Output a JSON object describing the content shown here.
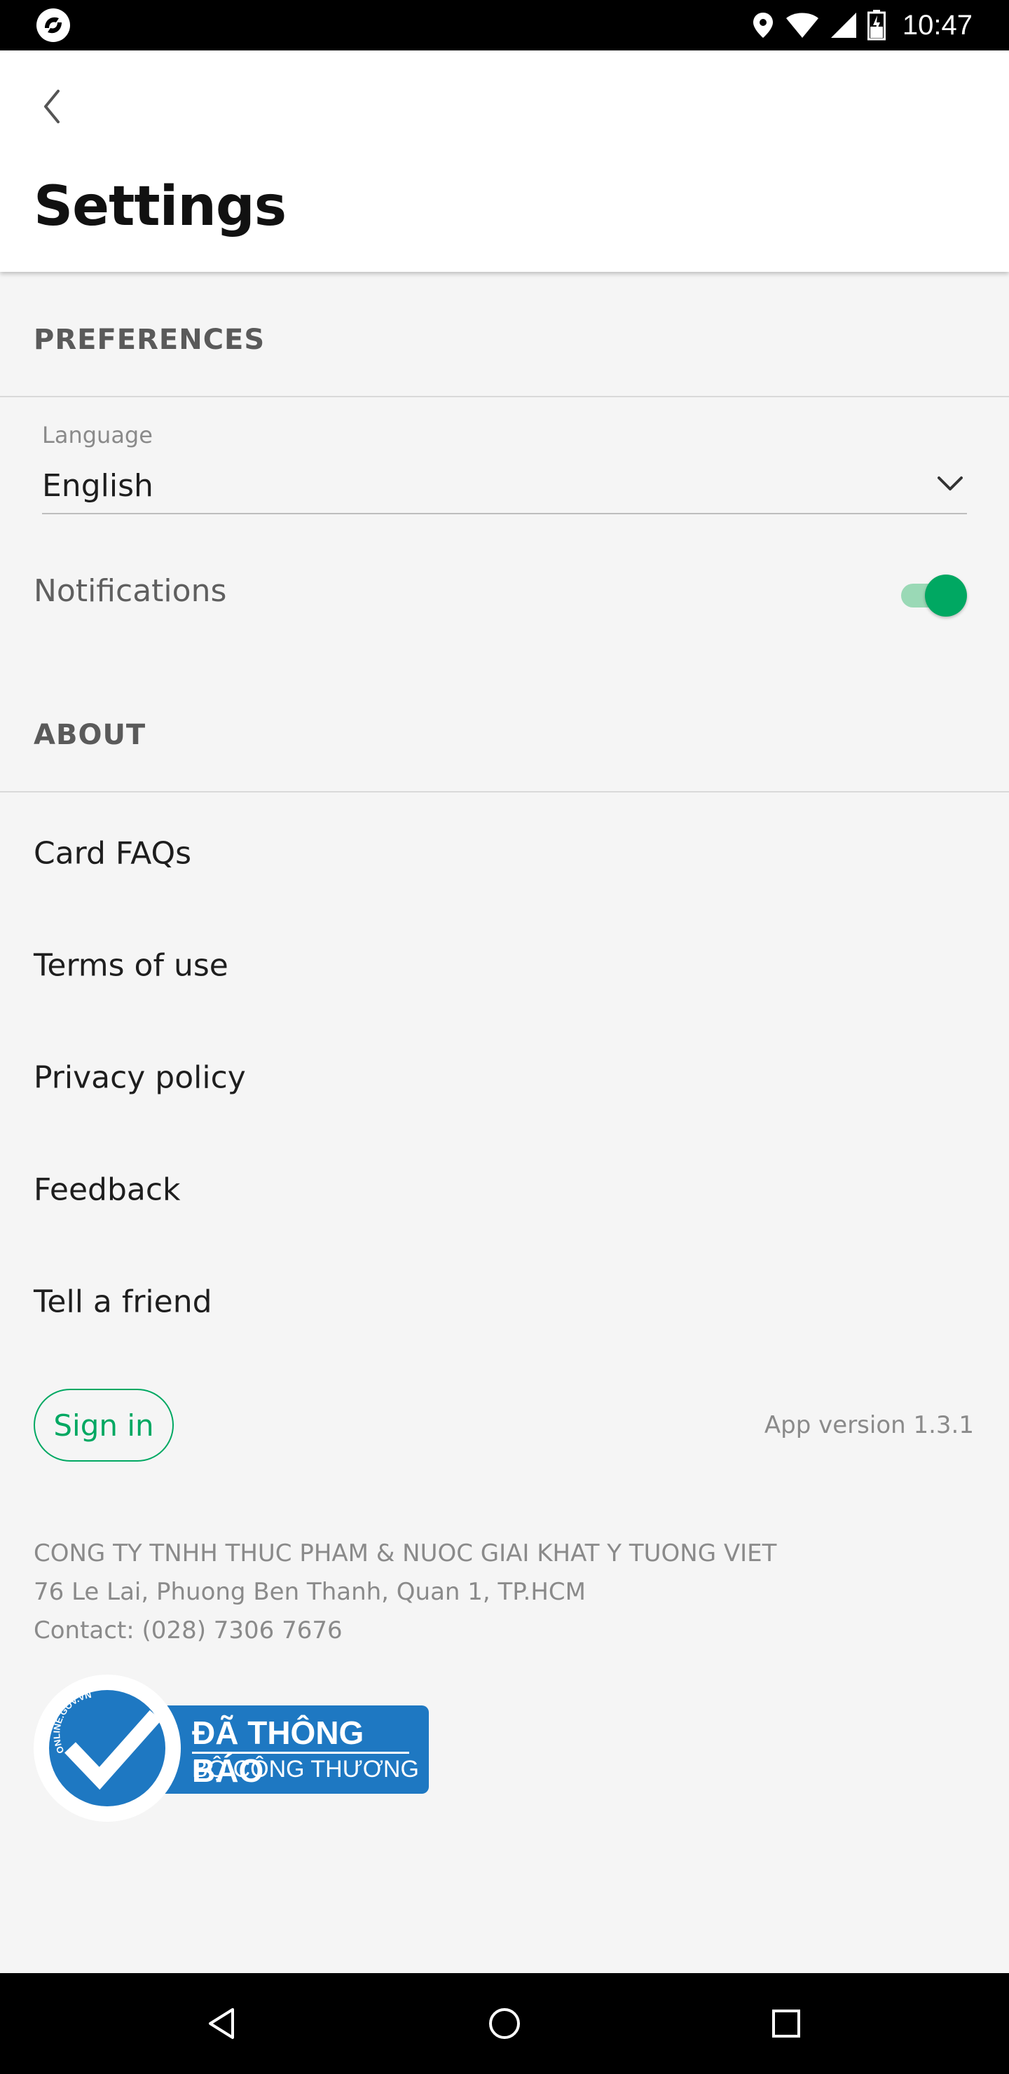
{
  "status_bar": {
    "time": "10:47",
    "icons": [
      "app-logo-icon",
      "location-icon",
      "wifi-icon",
      "signal-icon",
      "battery-icon"
    ]
  },
  "header": {
    "title": "Settings",
    "back_icon": "chevron-left-icon"
  },
  "preferences": {
    "section_title": "PREFERENCES",
    "language": {
      "label": "Language",
      "value": "English"
    },
    "notifications": {
      "label": "Notifications",
      "enabled": true
    }
  },
  "about": {
    "section_title": "ABOUT",
    "items": [
      {
        "label": "Card FAQs"
      },
      {
        "label": "Terms of use"
      },
      {
        "label": "Privacy policy"
      },
      {
        "label": "Feedback"
      },
      {
        "label": "Tell a friend"
      }
    ]
  },
  "footer": {
    "signin_label": "Sign in",
    "app_version": "App version 1.3.1",
    "company_name": "CONG TY TNHH THUC PHAM & NUOC GIAI KHAT Y TUONG VIET",
    "address": "76 Le Lai, Phuong Ben Thanh, Quan 1, TP.HCM",
    "contact": "Contact: (028) 7306 7676",
    "badge": {
      "arc_text": "ONLINE.GOV.VN",
      "line1": "ĐÃ THÔNG BÁO",
      "line2": "BỘ CÔNG THƯƠNG"
    }
  },
  "colors": {
    "accent": "#00a862",
    "badge_blue": "#1e78c2",
    "background": "#f5f5f5"
  },
  "nav_bar": {
    "icons": [
      "back-triangle-icon",
      "home-circle-icon",
      "recents-square-icon"
    ]
  }
}
